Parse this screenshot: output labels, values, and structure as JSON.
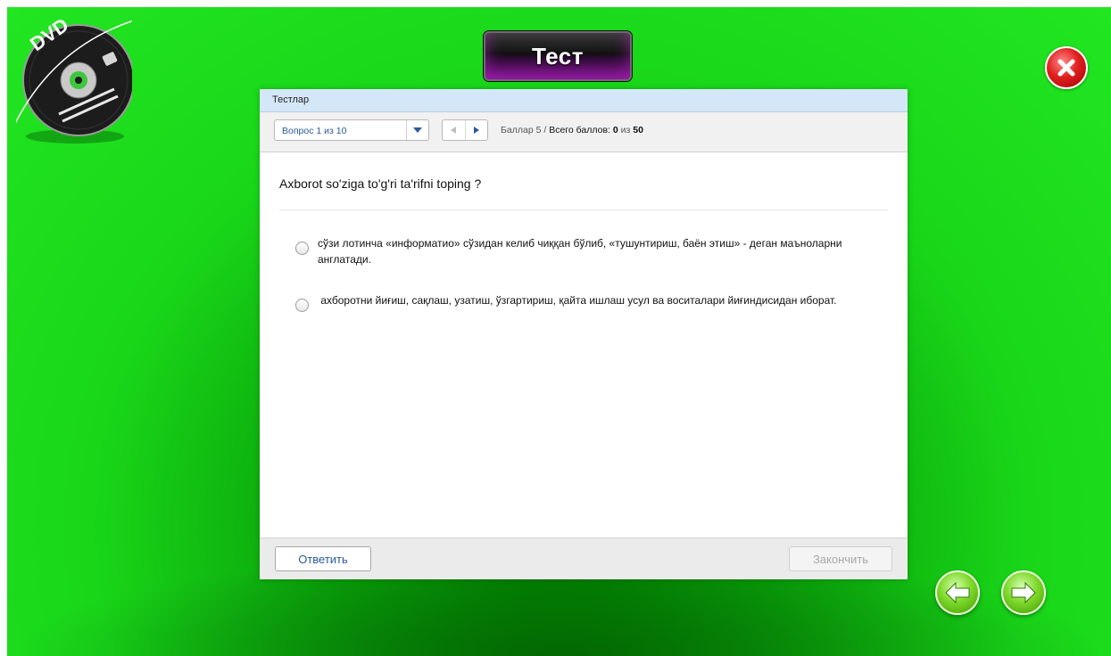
{
  "app": {
    "title": "Тест"
  },
  "panel": {
    "header_title": "Тестлар",
    "question_selector": "Вопрос 1 из 10",
    "score": {
      "label": "Баллар",
      "value": "5",
      "separator": "/",
      "total_label": "Всего баллов:",
      "earned": "0",
      "of_label": "из",
      "max": "50"
    },
    "question": "Axborot so'ziga to'g'ri ta'rifni toping ?",
    "options": [
      "сўзи лотинча «информатио» сўзидан келиб чиққан бўлиб, «тушунтириш, баён этиш» - деган маъноларни англатади.",
      " ахборотни йиғиш, сақлаш, узатиш, ўзгартириш, қайта ишлаш усул ва воситалари йиғиндисидан иборат."
    ],
    "answer_button": "Ответить",
    "finish_button": "Закончить"
  },
  "icons": {
    "logo": "dvd-logo",
    "close": "close-icon",
    "prev": "arrow-left-icon",
    "next": "arrow-right-icon"
  },
  "colors": {
    "background_green": "#22e622",
    "panel_header": "#d4e7f8",
    "close_red": "#e02020",
    "title_purple": "#5d0d69"
  }
}
